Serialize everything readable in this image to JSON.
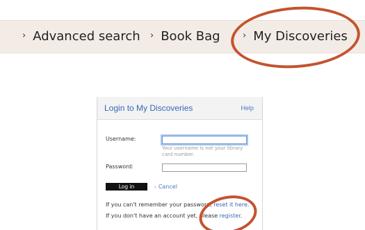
{
  "nav": {
    "chevron": "›",
    "items": [
      {
        "label": "Advanced search"
      },
      {
        "label": "Book Bag"
      },
      {
        "label": "My Discoveries"
      }
    ]
  },
  "login": {
    "title": "Login to My Discoveries",
    "help_label": "Help",
    "username_label": "Username:",
    "username_value": "",
    "username_hint": "Your username is not your library card number.",
    "password_label": "Password:",
    "password_value": "",
    "login_button": "Log in",
    "cancel_label": "Cancel",
    "reset_prefix": "If you can't remember your password, ",
    "reset_link": "reset it here",
    "reset_suffix": ".",
    "register_prefix": "If you don't have an account yet, please ",
    "register_link": "register",
    "register_suffix": "."
  },
  "colors": {
    "highlight": "#c4532e",
    "nav_background": "#f3ece6",
    "link": "#3a66b7"
  }
}
